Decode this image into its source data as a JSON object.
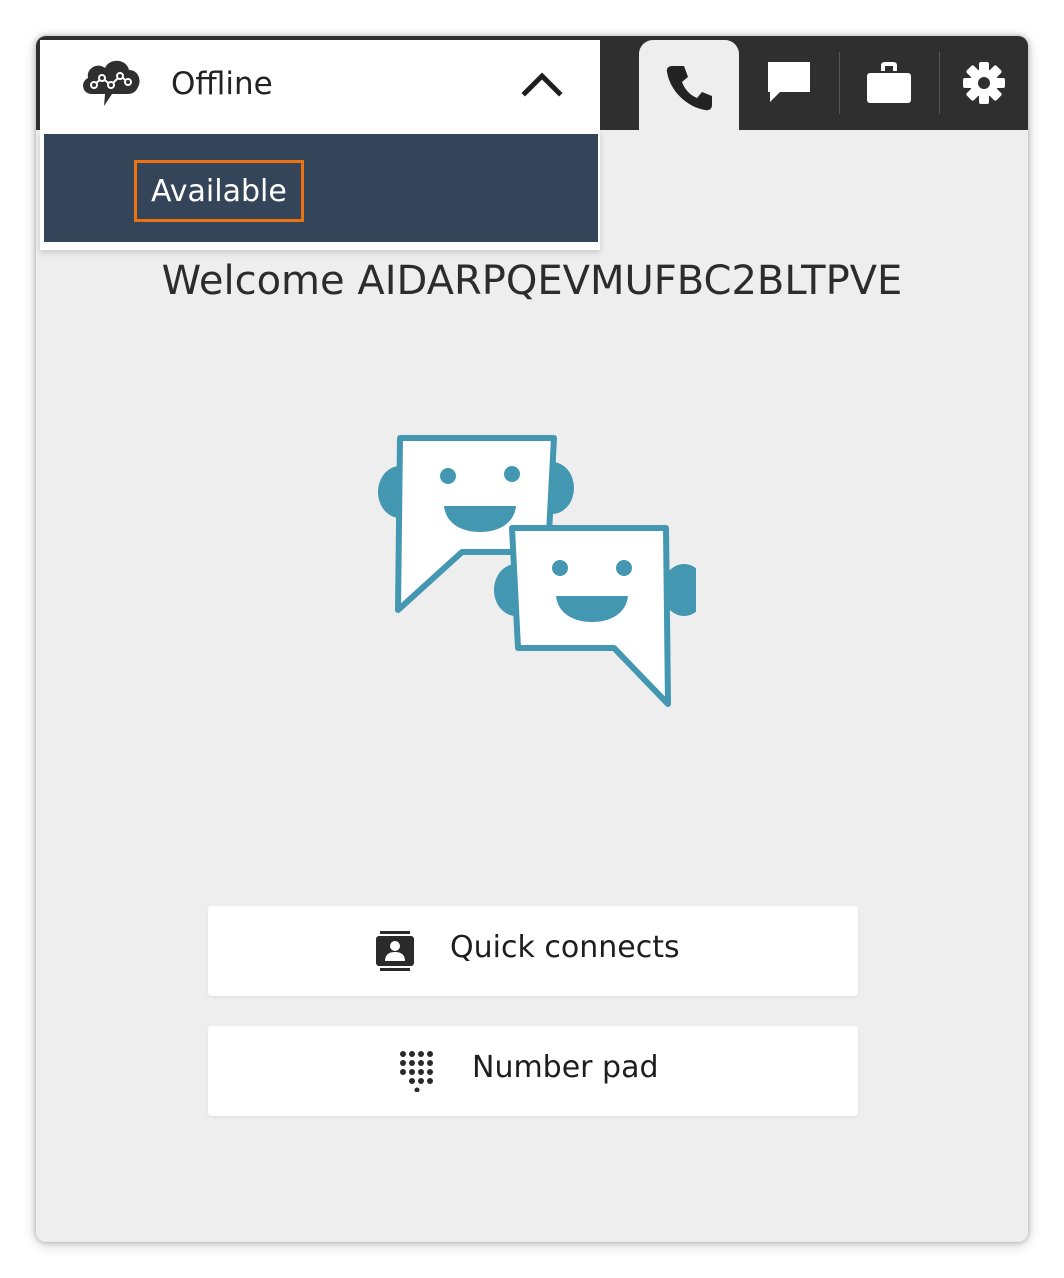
{
  "header": {
    "status": {
      "current_label": "Offline",
      "logo_icon": "cloud-chat-logo-icon",
      "toggle_icon": "chevron-up-icon"
    },
    "status_menu": {
      "items": [
        {
          "label": "Available",
          "highlighted": true
        }
      ]
    },
    "tabs": [
      {
        "icon": "phone-icon",
        "active": true
      },
      {
        "icon": "chat-icon",
        "active": false
      },
      {
        "icon": "briefcase-icon",
        "active": false
      },
      {
        "icon": "gear-icon",
        "active": false
      }
    ]
  },
  "main": {
    "welcome_text": "Welcome AIDARPQEVMUFBC2BLTPVE",
    "illustration_icon": "chatbot-faces-icon",
    "buttons": {
      "quick_connects": {
        "label": "Quick connects",
        "icon": "contacts-card-icon"
      },
      "number_pad": {
        "label": "Number pad",
        "icon": "dialpad-icon"
      }
    }
  },
  "colors": {
    "topbar": "#2f2f2f",
    "menu_background": "#344559",
    "highlight_border": "#ec7211",
    "illustration": "#4397b0",
    "panel_background": "#eeeeee"
  }
}
